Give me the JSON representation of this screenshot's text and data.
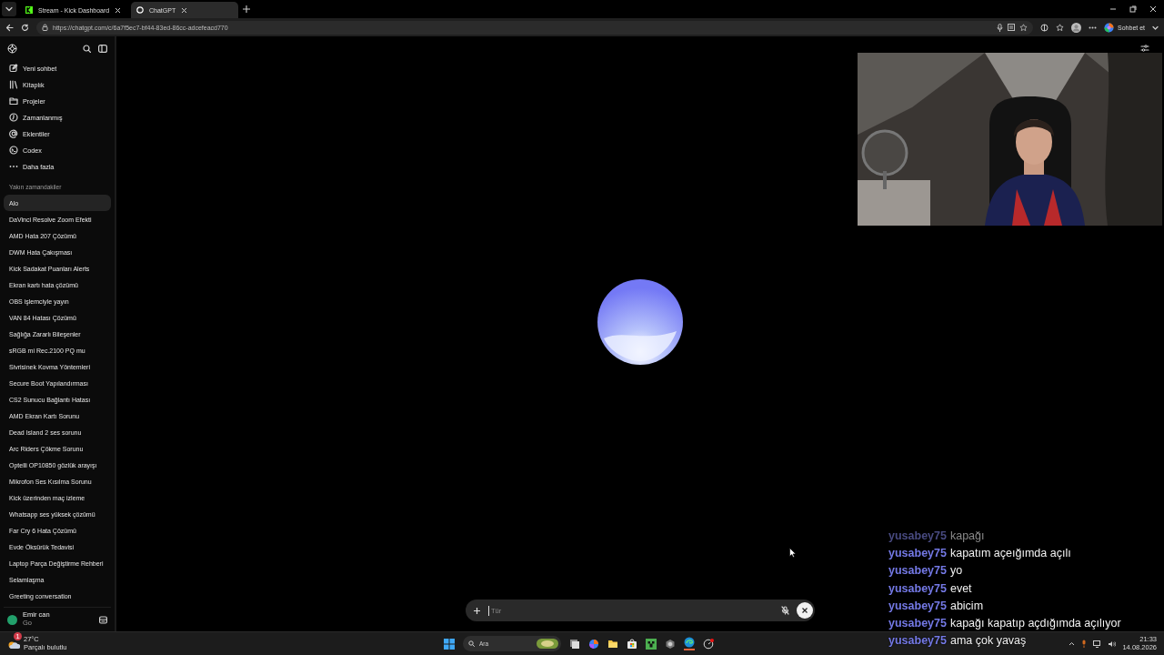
{
  "browser": {
    "tabs": [
      {
        "title": "Stream - Kick Dashboard",
        "selected": false
      },
      {
        "title": "ChatGPT",
        "selected": true
      }
    ],
    "url": "https://chatgpt.com/c/6a7f5ec7-bf44-83ed-86cc-adcefeacd770",
    "copilot_button": "Sohbet et"
  },
  "sidebar": {
    "nav": [
      {
        "label": "Yeni sohbet"
      },
      {
        "label": "Kitaplık"
      },
      {
        "label": "Projeler"
      },
      {
        "label": "Zamanlanmış"
      },
      {
        "label": "Eklentiler"
      },
      {
        "label": "Codex"
      },
      {
        "label": "Daha fazla"
      }
    ],
    "section_title": "Yakın zamandakiler",
    "chats": [
      {
        "title": "Alo",
        "selected": true
      },
      {
        "title": "DaVinci Resolve Zoom Efekti",
        "selected": false
      },
      {
        "title": "AMD Hata 207 Çözümü",
        "selected": false
      },
      {
        "title": "DWM Hata Çakışması",
        "selected": false
      },
      {
        "title": "Kick Sadakat Puanları Alerts",
        "selected": false
      },
      {
        "title": "Ekran kartı hata çözümü",
        "selected": false
      },
      {
        "title": "OBS işlemciyle yayın",
        "selected": false
      },
      {
        "title": "VAN 84 Hatası Çözümü",
        "selected": false
      },
      {
        "title": "Sağlığa Zararlı Bileşenler",
        "selected": false
      },
      {
        "title": "sRGB mi Rec.2100 PQ mu",
        "selected": false
      },
      {
        "title": "Sivrisinek Kovma Yöntemleri",
        "selected": false
      },
      {
        "title": "Secure Boot Yapılandırması",
        "selected": false
      },
      {
        "title": "CS2 Sunucu Bağlantı Hatası",
        "selected": false
      },
      {
        "title": "AMD Ekran Kartı Sorunu",
        "selected": false
      },
      {
        "title": "Dead Island 2 ses sorunu",
        "selected": false
      },
      {
        "title": "Arc Riders Çökme Sorunu",
        "selected": false
      },
      {
        "title": "Optelli OP10850 gözlük arayışı",
        "selected": false
      },
      {
        "title": "Mikrofon Ses Kısılma Sorunu",
        "selected": false
      },
      {
        "title": "Kick üzerinden maç izleme",
        "selected": false
      },
      {
        "title": "Whatsapp ses yüksek çözümü",
        "selected": false
      },
      {
        "title": "Far Cry 6 Hata Çözümü",
        "selected": false
      },
      {
        "title": "Evde Öksürük Tedavisi",
        "selected": false
      },
      {
        "title": "Laptop Parça Değiştirme Rehberi",
        "selected": false
      },
      {
        "title": "Selamlaşma",
        "selected": false
      },
      {
        "title": "Greeting conversation",
        "selected": false
      }
    ],
    "user": {
      "name": "Emir can",
      "plan": "Go"
    }
  },
  "composer": {
    "placeholder": "Tür"
  },
  "stream_chat": {
    "messages": [
      {
        "user": "yusabey75",
        "text": "kapağı",
        "faded": true
      },
      {
        "user": "yusabey75",
        "text": "kapatım açeığımda açılı",
        "faded": false
      },
      {
        "user": "yusabey75",
        "text": "yo",
        "faded": false
      },
      {
        "user": "yusabey75",
        "text": "evet",
        "faded": false
      },
      {
        "user": "yusabey75",
        "text": "abicim",
        "faded": false
      },
      {
        "user": "yusabey75",
        "text": "kapağı kapatıp açdığımda açılıyor",
        "faded": false
      },
      {
        "user": "yusabey75",
        "text": "ama çok yavaş",
        "faded": false
      }
    ]
  },
  "taskbar": {
    "weather": {
      "temperature": "27°C",
      "condition": "Parçalı bulutlu",
      "alert_count": "1"
    },
    "search_placeholder": "Ara",
    "time": "21:33",
    "date": "14.08.2026"
  }
}
